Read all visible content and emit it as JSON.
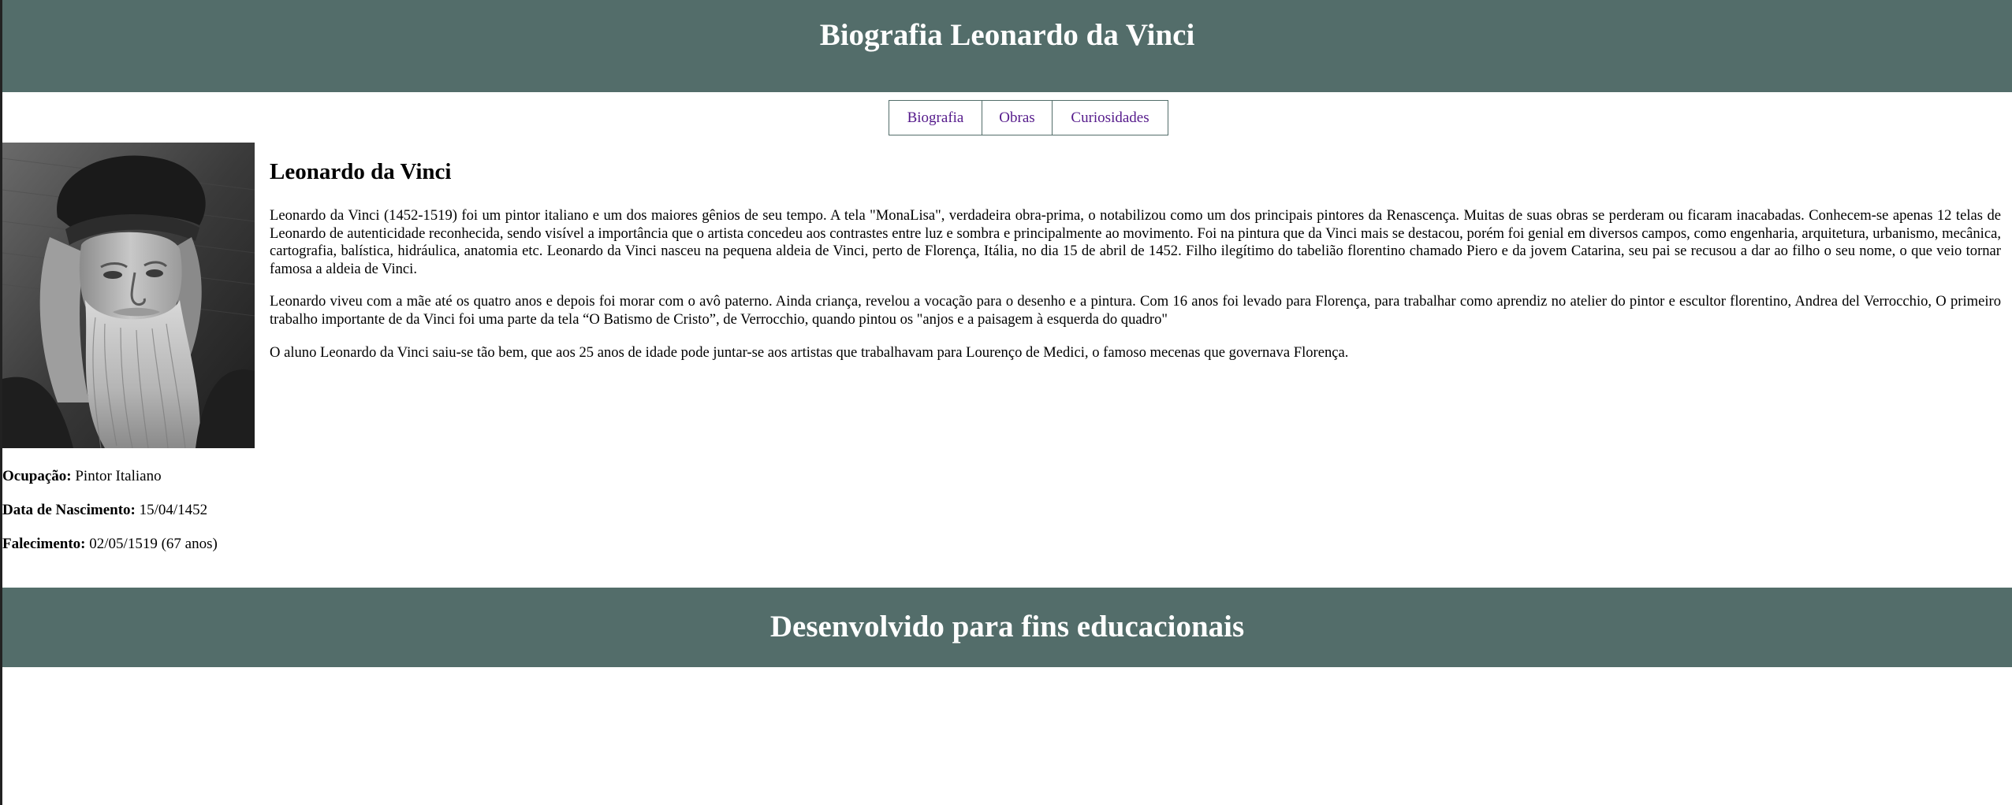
{
  "header": {
    "title": "Biografia Leonardo da Vinci"
  },
  "nav": {
    "items": [
      {
        "label": "Biografia"
      },
      {
        "label": "Obras"
      },
      {
        "label": "Curiosidades"
      }
    ]
  },
  "sidebar": {
    "portrait_alt": "portrait",
    "occupation_label": "Ocupação:",
    "occupation_value": " Pintor Italiano",
    "birth_label": "Data de Nascimento:",
    "birth_value": " 15/04/1452",
    "death_label": "Falecimento:",
    "death_value": " 02/05/1519 (67 anos)"
  },
  "main": {
    "heading": "Leonardo da Vinci",
    "paragraphs": [
      "Leonardo da Vinci (1452-1519) foi um pintor italiano e um dos maiores gênios de seu tempo. A tela \"MonaLisa\", verdadeira obra-prima, o notabilizou como um dos principais pintores da Renascença. Muitas de suas obras se perderam ou ficaram inacabadas. Conhecem-se apenas 12 telas de Leonardo de autenticidade reconhecida, sendo visível a importância que o artista concedeu aos contrastes entre luz e sombra e principalmente ao movimento. Foi na pintura que da Vinci mais se destacou, porém foi genial em diversos campos, como engenharia, arquitetura, urbanismo, mecânica, cartografia, balística, hidráulica, anatomia etc. Leonardo da Vinci nasceu na pequena aldeia de Vinci, perto de Florença, Itália, no dia 15 de abril de 1452. Filho ilegítimo do tabelião florentino chamado Piero e da jovem Catarina, seu pai se recusou a dar ao filho o seu nome, o que veio tornar famosa a aldeia de Vinci.",
      "Leonardo viveu com a mãe até os quatro anos e depois foi morar com o avô paterno. Ainda criança, revelou a vocação para o desenho e a pintura. Com 16 anos foi levado para Florença, para trabalhar como aprendiz no atelier do pintor e escultor florentino, Andrea del Verrocchio, O primeiro trabalho importante de da Vinci foi uma parte da tela “O Batismo de Cristo”, de Verrocchio, quando pintou os \"anjos e a paisagem à esquerda do quadro\"",
      "O aluno Leonardo da Vinci saiu-se tão bem, que aos 25 anos de idade pode juntar-se aos artistas que trabalhavam para Lourenço de Medici, o famoso mecenas que governava Florença."
    ]
  },
  "footer": {
    "text": "Desenvolvido para fins educacionais"
  },
  "colors": {
    "header_bg": "#536d6a",
    "link": "#551a8b"
  }
}
